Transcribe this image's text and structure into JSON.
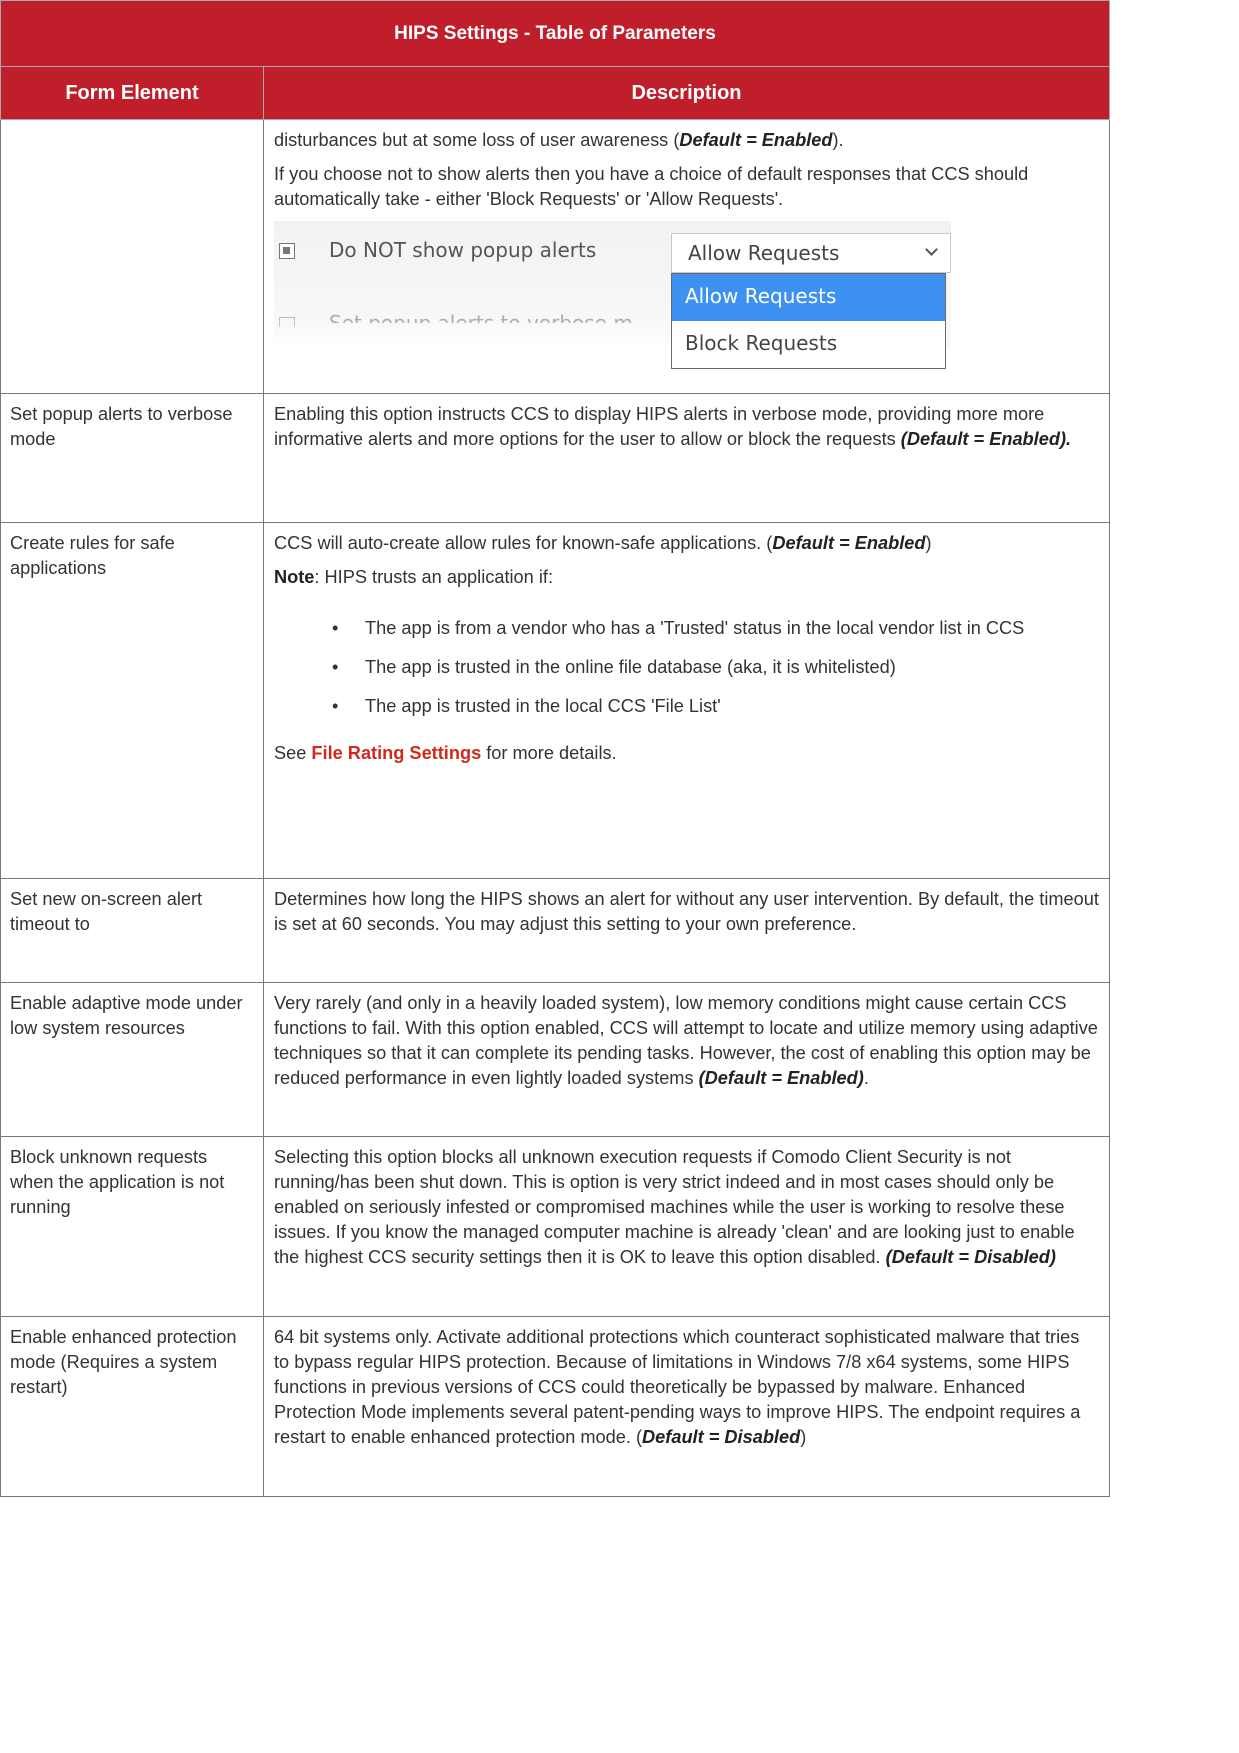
{
  "table": {
    "title": "HIPS Settings - Table of Parameters",
    "col_element": "Form Element",
    "col_description": "Description"
  },
  "row0": {
    "p1": "disturbances but at some loss of user awareness (",
    "p1_default": "Default = Enabled",
    "p1_end": ").",
    "p2": "If you choose not to show alerts then you have a choice of default responses that CCS should automatically take - either 'Block Requests' or 'Allow Requests'.",
    "shot": {
      "checkbox_label": "Do NOT show popup alerts",
      "dropdown_value": "Allow Requests",
      "options": [
        "Allow Requests",
        "Block Requests"
      ],
      "hidden_label": "Set popup alerts to verbose m"
    }
  },
  "row_verbose": {
    "element": "Set popup alerts to verbose mode",
    "desc": "Enabling this option instructs CCS to display HIPS alerts in verbose mode, providing more more informative alerts and more options for the user to allow or block the requests ",
    "default": "(Default = Enabled)."
  },
  "row_safe": {
    "element": "Create rules for safe applications",
    "desc": "CCS will auto-create allow rules for known-safe applications. (",
    "default": "Default = Enabled",
    "desc_end": ")",
    "note_label": "Note",
    "note_text": ": HIPS trusts an application if:",
    "bullets": [
      "The app is from a vendor who has a 'Trusted' status in the local vendor list in CCS",
      "The app is trusted in the online file database (aka, it is whitelisted)",
      "The app is trusted in the local CCS 'File List'"
    ],
    "see": "See ",
    "link": "File Rating Settings",
    "see_end": " for more details."
  },
  "row_timeout": {
    "element": "Set new on-screen alert timeout to",
    "desc": "Determines how long the HIPS shows an alert for without any user intervention. By default, the timeout is set at 60 seconds. You may adjust this setting to your own preference."
  },
  "row_adaptive": {
    "element": "Enable adaptive mode under low system resources",
    "desc": "Very rarely (and only in a heavily loaded system), low memory conditions might cause certain CCS functions to fail. With this option enabled, CCS will attempt to locate and utilize memory using adaptive techniques so that it can complete its pending tasks. However, the cost of enabling this option may be reduced performance in even lightly loaded systems ",
    "default": "(Default = Enabled)",
    "desc_end": "."
  },
  "row_block": {
    "element": "Block unknown requests when the application is not running",
    "desc": "Selecting this option blocks all unknown execution requests if Comodo Client Security is not running/has been shut down. This is option is very strict indeed and in most cases should only be enabled on seriously infested or compromised machines while the user is working to resolve these issues. If you know the managed computer machine is already 'clean' and are looking just to enable the highest CCS security settings then it is OK to leave this option disabled. ",
    "default": "(Default = Disabled)"
  },
  "row_enhanced": {
    "element": "Enable enhanced protection mode (Requires a system restart)",
    "desc": "64 bit systems only. Activate additional protections which counteract sophisticated malware that tries to bypass regular HIPS protection. Because of limitations in Windows 7/8 x64 systems, some HIPS functions in previous versions of CCS could theoretically be bypassed by malware. Enhanced Protection Mode implements several patent-pending ways to improve HIPS. The endpoint requires a restart to enable enhanced protection mode. (",
    "default": "Default = Disabled",
    "desc_end": ")"
  },
  "colors": {
    "header_bg": "#c11e2b",
    "link": "#d12a1c",
    "selected_option": "#3d91f0"
  }
}
